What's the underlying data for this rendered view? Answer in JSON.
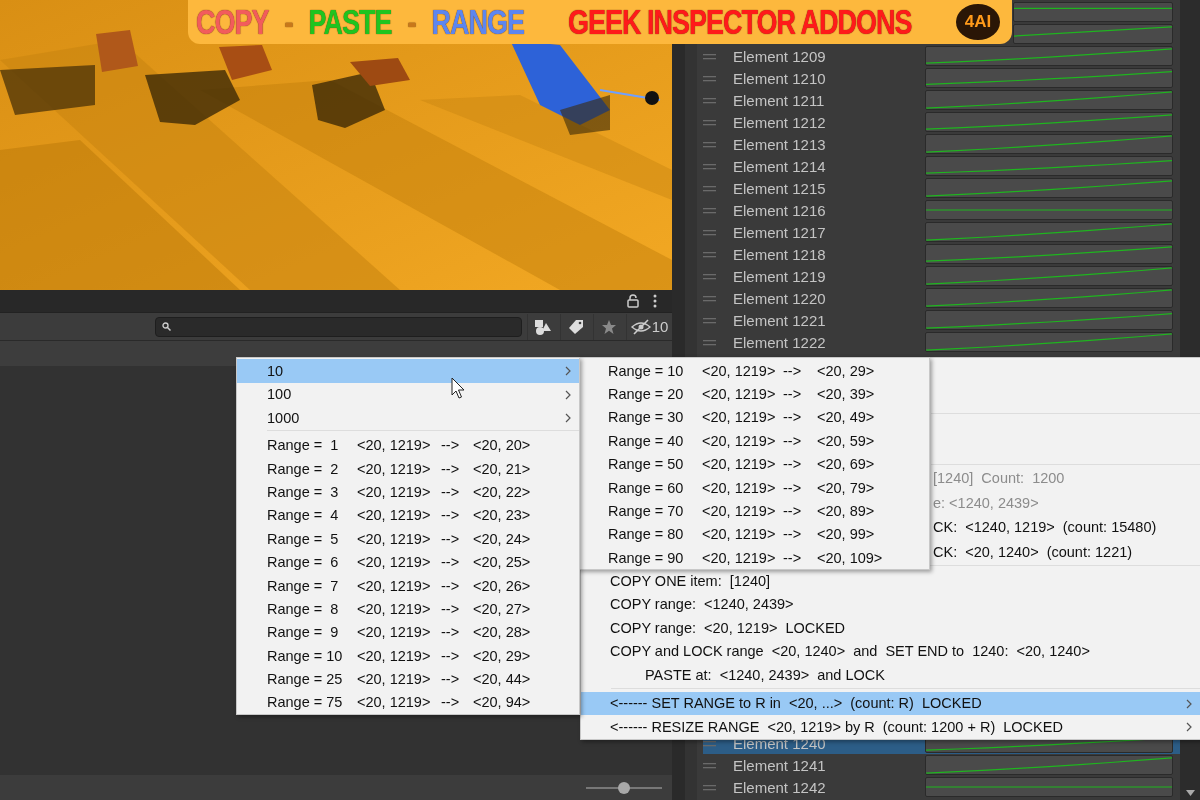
{
  "banner": {
    "words": [
      {
        "text": "COPY",
        "color": "#f25c5c"
      },
      {
        "text": "-",
        "color": "#c8781a"
      },
      {
        "text": "PASTE",
        "color": "#1fc41f"
      },
      {
        "text": "-",
        "color": "#c8781a"
      },
      {
        "text": "RANGE",
        "color": "#5c86f0"
      },
      {
        "text": "GEEK INSPECTOR ADDONS",
        "color": "#ff1a1a"
      }
    ],
    "logo": "4AI"
  },
  "toolbar": {
    "hidden_count": "10"
  },
  "zoom_slider": {
    "level": 0.5
  },
  "list": {
    "rows_top": [
      {
        "label": "Element 1209",
        "selected": false
      },
      {
        "label": "Element 1210",
        "selected": false
      },
      {
        "label": "Element 1211",
        "selected": false
      },
      {
        "label": "Element 1212",
        "selected": false
      },
      {
        "label": "Element 1213",
        "selected": false
      },
      {
        "label": "Element 1214",
        "selected": false
      },
      {
        "label": "Element 1215",
        "selected": false
      },
      {
        "label": "Element 1216",
        "selected": false
      },
      {
        "label": "Element 1217",
        "selected": false
      },
      {
        "label": "Element 1218",
        "selected": false
      },
      {
        "label": "Element 1219",
        "selected": false
      },
      {
        "label": "Element 1220",
        "selected": false
      },
      {
        "label": "Element 1221",
        "selected": false
      },
      {
        "label": "Element 1222",
        "selected": false
      }
    ],
    "rows_bottom": [
      {
        "label": "Element 1240",
        "selected": true
      },
      {
        "label": "Element 1241",
        "selected": false
      },
      {
        "label": "Element 1242",
        "selected": false
      }
    ]
  },
  "context_menu": {
    "items": [
      {
        "kind": "partial",
        "text": "[1240]  Count:  1200",
        "disabled": true,
        "selected": false
      },
      {
        "kind": "partial",
        "text": "e: <1240, 2439>",
        "disabled": true,
        "selected": false
      },
      {
        "kind": "partial",
        "text": "CK:  <1240, 1219>  (count: 15480)",
        "disabled": false,
        "selected": false
      },
      {
        "kind": "partial",
        "text": "CK:  <20, 1240>  (count: 1221)",
        "disabled": false,
        "selected": false
      },
      {
        "kind": "separator"
      },
      {
        "kind": "action",
        "text": "COPY ONE item:  [1240]",
        "disabled": false,
        "selected": false
      },
      {
        "kind": "action",
        "text": "COPY range:  <1240, 2439>",
        "disabled": false,
        "selected": false
      },
      {
        "kind": "action",
        "text": "COPY range:  <20, 1219>  LOCKED",
        "disabled": false,
        "selected": false
      },
      {
        "kind": "action",
        "text": "COPY and LOCK range  <20, 1240>  and  SET END to  1240:  <20, 1240>",
        "disabled": false,
        "selected": false
      },
      {
        "kind": "indented",
        "text": "PASTE at:  <1240, 2439>  and LOCK",
        "disabled": false,
        "selected": false
      },
      {
        "kind": "separator"
      },
      {
        "kind": "submenu",
        "text": "<------ SET RANGE to R in  <20, ...>  (count: R)  LOCKED",
        "disabled": false,
        "selected": true
      },
      {
        "kind": "submenu",
        "text": "<------ RESIZE RANGE  <20, 1219> by R  (count: 1200 + R)  LOCKED",
        "disabled": false,
        "selected": false
      }
    ]
  },
  "range_menu": {
    "steps": [
      {
        "label": "10",
        "selected": true
      },
      {
        "label": "100",
        "selected": false
      },
      {
        "label": "1000",
        "selected": false
      }
    ],
    "ranges": [
      {
        "range": "Range =  1",
        "from": "<20, 1219>",
        "arrow": "-->",
        "to": "<20, 20>"
      },
      {
        "range": "Range =  2",
        "from": "<20, 1219>",
        "arrow": "-->",
        "to": "<20, 21>"
      },
      {
        "range": "Range =  3",
        "from": "<20, 1219>",
        "arrow": "-->",
        "to": "<20, 22>"
      },
      {
        "range": "Range =  4",
        "from": "<20, 1219>",
        "arrow": "-->",
        "to": "<20, 23>"
      },
      {
        "range": "Range =  5",
        "from": "<20, 1219>",
        "arrow": "-->",
        "to": "<20, 24>"
      },
      {
        "range": "Range =  6",
        "from": "<20, 1219>",
        "arrow": "-->",
        "to": "<20, 25>"
      },
      {
        "range": "Range =  7",
        "from": "<20, 1219>",
        "arrow": "-->",
        "to": "<20, 26>"
      },
      {
        "range": "Range =  8",
        "from": "<20, 1219>",
        "arrow": "-->",
        "to": "<20, 27>"
      },
      {
        "range": "Range =  9",
        "from": "<20, 1219>",
        "arrow": "-->",
        "to": "<20, 28>"
      },
      {
        "range": "Range = 10",
        "from": "<20, 1219>",
        "arrow": "-->",
        "to": "<20, 29>"
      },
      {
        "range": "Range = 25",
        "from": "<20, 1219>",
        "arrow": "-->",
        "to": "<20, 44>"
      },
      {
        "range": "Range = 75",
        "from": "<20, 1219>",
        "arrow": "-->",
        "to": "<20, 94>"
      }
    ]
  },
  "tens_menu": {
    "ranges": [
      {
        "range": "Range = 10",
        "from": "<20, 1219>",
        "arrow": "-->",
        "to": "<20, 29>"
      },
      {
        "range": "Range = 20",
        "from": "<20, 1219>",
        "arrow": "-->",
        "to": "<20, 39>"
      },
      {
        "range": "Range = 30",
        "from": "<20, 1219>",
        "arrow": "-->",
        "to": "<20, 49>"
      },
      {
        "range": "Range = 40",
        "from": "<20, 1219>",
        "arrow": "-->",
        "to": "<20, 59>"
      },
      {
        "range": "Range = 50",
        "from": "<20, 1219>",
        "arrow": "-->",
        "to": "<20, 69>"
      },
      {
        "range": "Range = 60",
        "from": "<20, 1219>",
        "arrow": "-->",
        "to": "<20, 79>"
      },
      {
        "range": "Range = 70",
        "from": "<20, 1219>",
        "arrow": "-->",
        "to": "<20, 89>"
      },
      {
        "range": "Range = 80",
        "from": "<20, 1219>",
        "arrow": "-->",
        "to": "<20, 99>"
      },
      {
        "range": "Range = 90",
        "from": "<20, 1219>",
        "arrow": "-->",
        "to": "<20, 109>"
      }
    ]
  }
}
